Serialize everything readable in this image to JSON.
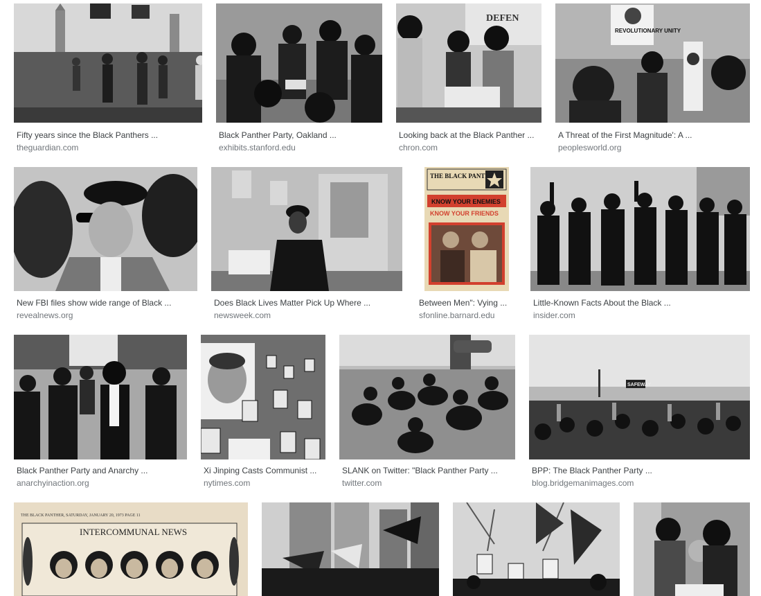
{
  "results": [
    {
      "title": "Fifty years since the Black Panthers ...",
      "source": "theguardian.com"
    },
    {
      "title": "Black Panther Party, Oakland ...",
      "source": "exhibits.stanford.edu"
    },
    {
      "title": "Looking back at the Black Panther ...",
      "source": "chron.com"
    },
    {
      "title": "A Threat of the First Magnitude': A ...",
      "source": "peoplesworld.org"
    },
    {
      "title": "New FBI files show wide range of Black ...",
      "source": "revealnews.org"
    },
    {
      "title": "Does Black Lives Matter Pick Up Where ...",
      "source": "newsweek.com"
    },
    {
      "title": "Between Men\": Vying ...",
      "source": "sfonline.barnard.edu"
    },
    {
      "title": "Little-Known Facts About the Black ...",
      "source": "insider.com"
    },
    {
      "title": "Black Panther Party and Anarchy ...",
      "source": "anarchyinaction.org"
    },
    {
      "title": "Xi Jinping Casts Communist ...",
      "source": "nytimes.com"
    },
    {
      "title": "SLANK on Twitter: \"Black Panther Party ...",
      "source": "twitter.com"
    },
    {
      "title": "BPP: The Black Panther Party ...",
      "source": "blog.bridgemanimages.com"
    },
    {
      "title": "",
      "source": ""
    },
    {
      "title": "",
      "source": ""
    },
    {
      "title": "",
      "source": ""
    },
    {
      "title": "",
      "source": ""
    }
  ],
  "image_text": {
    "revolutionary_unity_sign": "REVOLUTIONARY UNITY",
    "newspaper_masthead": "THE BLACK PANTHER",
    "newspaper_headline_1": "KNOW YOUR ENEMIES",
    "newspaper_headline_2": "KNOW YOUR FRIENDS",
    "safeway_sign": "SAFEWAY",
    "intercommunal_news_header": "INTERCOMMUNAL NEWS",
    "defense_banner": "DEFEN",
    "clipping_header": "THE BLACK PANTHER, SATURDAY, JANUARY 20, 1973 PAGE 11"
  },
  "colors": {
    "title_text": "#3c4043",
    "source_text": "#70757a",
    "background": "#ffffff",
    "newspaper_red": "#d2402e",
    "newspaper_paper": "#e8d9b5"
  }
}
